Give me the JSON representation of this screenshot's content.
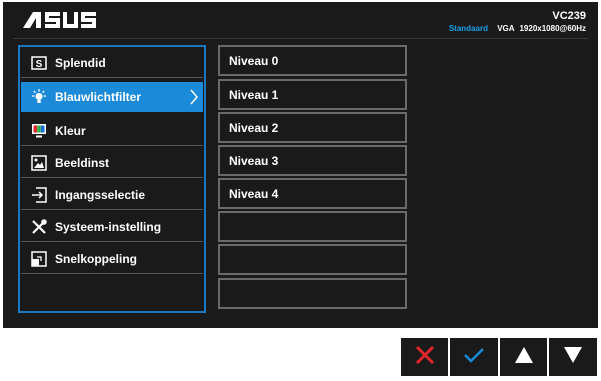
{
  "header": {
    "brand": "ASUS",
    "model": "VC239",
    "mode": "Standaard",
    "input": "VGA",
    "resolution": "1920x1080",
    "refresh": "@60Hz"
  },
  "menu": {
    "items": [
      {
        "label": "Splendid",
        "icon": "splendid-s-icon"
      },
      {
        "label": "Blauwlichtfilter",
        "icon": "bulb-icon",
        "selected": true
      },
      {
        "label": "Kleur",
        "icon": "color-monitor-icon"
      },
      {
        "label": "Beeldinst",
        "icon": "picture-icon"
      },
      {
        "label": "Ingangsselectie",
        "icon": "input-arrow-icon"
      },
      {
        "label": "Systeem-instelling",
        "icon": "tools-icon"
      },
      {
        "label": "Snelkoppeling",
        "icon": "shortcut-icon"
      }
    ]
  },
  "submenu": {
    "items": [
      "Niveau 0",
      "Niveau 1",
      "Niveau 2",
      "Niveau 3",
      "Niveau 4",
      "",
      "",
      ""
    ]
  },
  "buttons": {
    "icons": [
      "close-x-icon",
      "check-icon",
      "up-triangle-icon",
      "down-triangle-icon"
    ]
  },
  "colors": {
    "accent": "#1b8ad9",
    "osd_bg": "#1a1a1a",
    "close": "#e0262b",
    "check": "#1b8ad9"
  }
}
